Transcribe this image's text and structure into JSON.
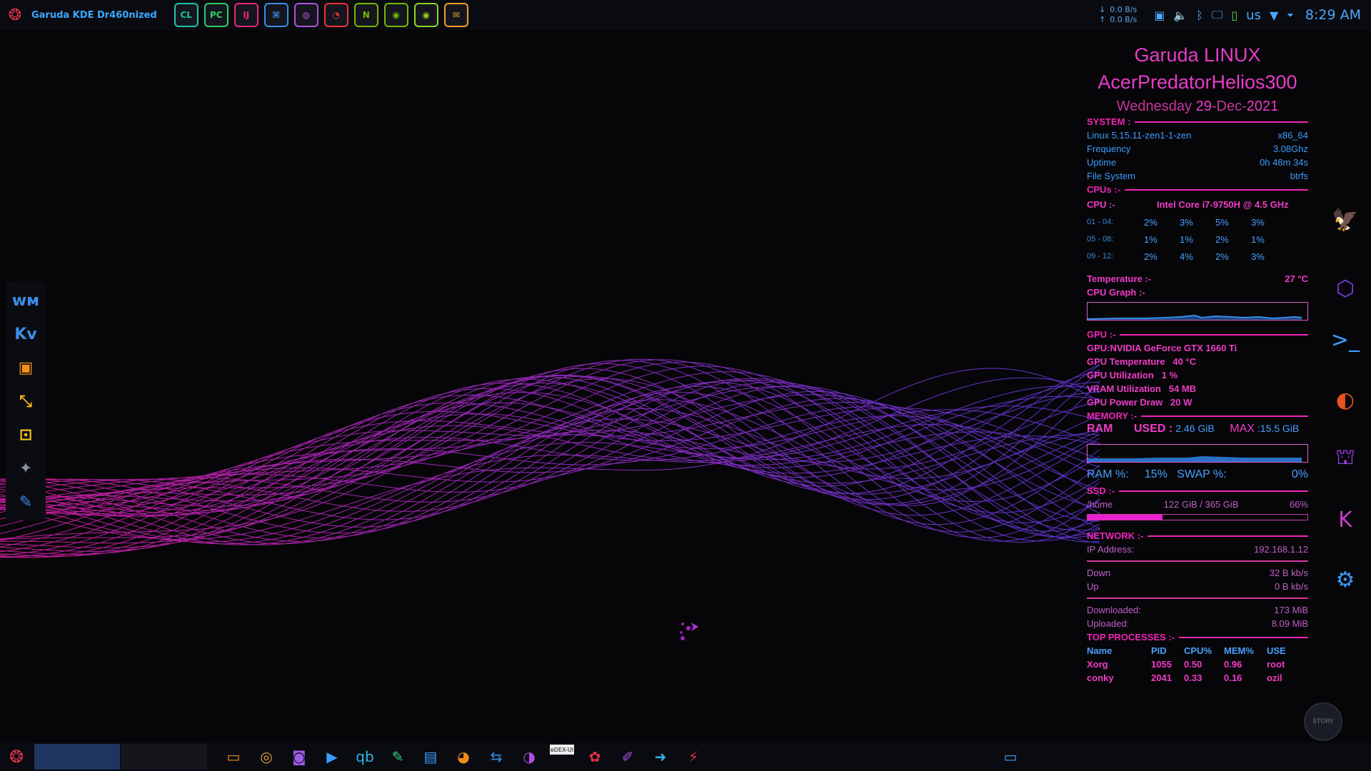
{
  "topbar": {
    "window_title": "Garuda KDE Dr460nized",
    "launchers": [
      {
        "name": "clion-icon",
        "text": "CL",
        "color": "#1fc4a8"
      },
      {
        "name": "pycharm-icon",
        "text": "PC",
        "color": "#2fcf6a"
      },
      {
        "name": "intellij-icon",
        "text": "IJ",
        "color": "#e6297a"
      },
      {
        "name": "vscode-icon",
        "text": "⌘",
        "color": "#3b8ee8"
      },
      {
        "name": "github-icon",
        "text": "◍",
        "color": "#b24fe0"
      },
      {
        "name": "speedometer-icon",
        "text": "◔",
        "color": "#e8333a"
      },
      {
        "name": "nvidia-settings-icon",
        "text": "N",
        "color": "#76b900"
      },
      {
        "name": "nvidia-icon",
        "text": "◉",
        "color": "#76b900"
      },
      {
        "name": "nvidia-x-icon",
        "text": "◉",
        "color": "#8ed428"
      },
      {
        "name": "globe-mail-icon",
        "text": "✉",
        "color": "#f0a030"
      }
    ],
    "net_down": "0.0 B/s",
    "net_up": "0.0 B/s",
    "keyboard_layout": "us",
    "clock": "8:29 AM"
  },
  "conky": {
    "distro": "Garuda LINUX",
    "host": "AcerPredatorHelios300",
    "date_day": "Wednesday",
    "date_num": "29",
    "date_rest": "-Dec-",
    "date_year": "2021",
    "system_header": "SYSTEM :",
    "kernel": "Linux 5.15.11-zen1-1-zen",
    "arch": "x86_64",
    "freq_label": "Frequency",
    "freq": "3.08Ghz",
    "uptime_label": "Uptime",
    "uptime": "0h 48m 34s",
    "fs_label": "File System",
    "fs": "btrfs",
    "cpus_header": "CPUs :-",
    "cpu_label": "CPU :-",
    "cpu_model": "Intel Core i7-9750H @ 4.5 GHz",
    "cores": [
      {
        "label": "01 - 04:",
        "vals": [
          "2%",
          "3%",
          "5%",
          "3%"
        ]
      },
      {
        "label": "05 - 08:",
        "vals": [
          "1%",
          "1%",
          "2%",
          "1%"
        ]
      },
      {
        "label": "09 - 12:",
        "vals": [
          "2%",
          "4%",
          "2%",
          "3%"
        ]
      }
    ],
    "temp_label": "Temperature :-",
    "temp": "27 °C",
    "cpu_graph_label": "CPU Graph  :-",
    "gpu_header": "GPU :-",
    "gpu_name": "GPU:NVIDIA GeForce GTX 1660 Ti",
    "gpu_temp_label": "GPU Temperature",
    "gpu_temp": "40 °C",
    "gpu_util_label": "GPU Utilization",
    "gpu_util": "1 %",
    "vram_label": "VRAM Utilization",
    "vram": "54 MB",
    "gpu_power_label": "GPU Power Draw",
    "gpu_power": "20 W",
    "memory_header": "MEMORY :-",
    "ram_label": "RAM",
    "used_label": "USED :",
    "ram_used": "2.46 GiB",
    "max_label": "MAX",
    "ram_max": ":15.5 GiB",
    "ram_pct_label": "RAM %:",
    "ram_pct": "15%",
    "swap_pct_label": "SWAP %:",
    "swap_pct": "0%",
    "ssd_header": "SSD :-",
    "mount": "/home",
    "disk_usage": "122 GiB / 365 GiB",
    "disk_pct": "66%",
    "disk_fill": 0.34,
    "network_header": "NETWORK :-",
    "ip_label": "IP Address:",
    "ip": "192.168.1.12",
    "down_label": "Down",
    "down": "32 B kb/s",
    "up_label": "Up",
    "up": "0 B kb/s",
    "downloaded_label": "Downloaded:",
    "downloaded": "173 MiB",
    "uploaded_label": "Uploaded:",
    "uploaded": "8.09 MiB",
    "proc_header": "TOP PROCESSES :-",
    "proc_cols": [
      "Name",
      "PID",
      "CPU%",
      "MEM%",
      "USE"
    ],
    "procs": [
      [
        "Xorg",
        "1055",
        "0.50",
        "0.96",
        "root"
      ],
      [
        "conky",
        "2041",
        "0.33",
        "0.16",
        "ozil"
      ]
    ]
  },
  "dock_left": [
    {
      "name": "waveform-app-icon",
      "glyph": "ᴡᴍ",
      "color": "#3b8ee8"
    },
    {
      "name": "kdenlive-icon",
      "glyph": "Kv",
      "color": "#3b8ee8"
    },
    {
      "name": "virtualbox-icon",
      "glyph": "▣",
      "color": "#f29018"
    },
    {
      "name": "arrows-app-icon",
      "glyph": "⤡",
      "color": "#f2b418"
    },
    {
      "name": "network-app-icon",
      "glyph": "⊡",
      "color": "#f2c418"
    },
    {
      "name": "predator-icon",
      "glyph": "✦",
      "color": "#8a90a0"
    },
    {
      "name": "feather-icon",
      "glyph": "✎",
      "color": "#3b8ee8"
    }
  ],
  "dock_right": [
    {
      "name": "garuda-eagle-icon",
      "glyph": "🦅",
      "color": "#e0303a"
    },
    {
      "name": "garuda-assistant-icon",
      "glyph": "⬡",
      "color": "#7a3ce8"
    },
    {
      "name": "terminal-icon",
      "glyph": ">_",
      "color": "#3a9cff"
    },
    {
      "name": "dragon-icon",
      "glyph": "◐",
      "color": "#e8531f"
    },
    {
      "name": "store-bag-icon",
      "glyph": "⛫",
      "color": "#9a40e8"
    },
    {
      "name": "kde-connect-icon",
      "glyph": "K",
      "color": "#c83cc8"
    },
    {
      "name": "settings-gear-icon",
      "glyph": "⚙",
      "color": "#3a9cff"
    }
  ],
  "bottombar": {
    "apps": [
      {
        "name": "file-manager-icon",
        "glyph": "▭",
        "color": "#f28a18"
      },
      {
        "name": "chrome-icon",
        "glyph": "◎",
        "color": "#e8a040"
      },
      {
        "name": "discord-icon",
        "glyph": "◙",
        "color": "#9a5ce8"
      },
      {
        "name": "video-call-icon",
        "glyph": "▶",
        "color": "#3a9cff"
      },
      {
        "name": "qbittorrent-icon",
        "glyph": "qb",
        "color": "#2fb8e8"
      },
      {
        "name": "usb-writer-icon",
        "glyph": "✎",
        "color": "#3fd08a"
      },
      {
        "name": "disk-icon",
        "glyph": "▤",
        "color": "#3a9cff"
      },
      {
        "name": "partition-icon",
        "glyph": "◕",
        "color": "#f28a18"
      },
      {
        "name": "teamviewer-icon",
        "glyph": "⇆",
        "color": "#2f8ee8"
      },
      {
        "name": "obs-icon",
        "glyph": "◑",
        "color": "#b04ce8"
      },
      {
        "name": "edex-icon",
        "glyph": "eDEX-UI",
        "color": "#e8e8e8"
      },
      {
        "name": "raspberry-icon",
        "glyph": "✿",
        "color": "#e8304a"
      },
      {
        "name": "pen-icon",
        "glyph": "✐",
        "color": "#b04ce8"
      },
      {
        "name": "send-icon",
        "glyph": "➜",
        "color": "#2fb8e8"
      },
      {
        "name": "flash-icon",
        "glyph": "⚡",
        "color": "#e8304a"
      }
    ],
    "show_desktop_glyph": "▭"
  },
  "badge_text": "STORY"
}
